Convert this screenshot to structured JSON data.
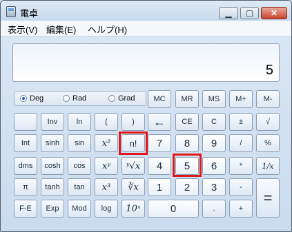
{
  "window": {
    "title": "電卓"
  },
  "menu": [
    "表示(V)",
    "編集(E)",
    "ヘルプ(H)"
  ],
  "display": {
    "value": "5"
  },
  "angle_mode": {
    "options": [
      "Deg",
      "Rad",
      "Grad"
    ],
    "selected": "Deg"
  },
  "memory_buttons": [
    "MC",
    "MR",
    "MS",
    "M+",
    "M-"
  ],
  "row2": [
    "Inv",
    "ln",
    "(",
    ")",
    "←",
    "CE",
    "C",
    "±",
    "√"
  ],
  "row3": [
    "Int",
    "sinh",
    "sin",
    "x²",
    "n!",
    "7",
    "8",
    "9",
    "/",
    "%"
  ],
  "row4": [
    "dms",
    "cosh",
    "cos",
    "xʸ",
    "ʸ√x",
    "4",
    "5",
    "6",
    "*",
    "1/x"
  ],
  "row5": [
    "π",
    "tanh",
    "tan",
    "x³",
    "∛x",
    "1",
    "2",
    "3",
    "-",
    "="
  ],
  "row6": [
    "F-E",
    "Exp",
    "Mod",
    "log",
    "10ˣ",
    "0",
    ".",
    "+"
  ],
  "highlighted_buttons": [
    "n!",
    "5"
  ]
}
